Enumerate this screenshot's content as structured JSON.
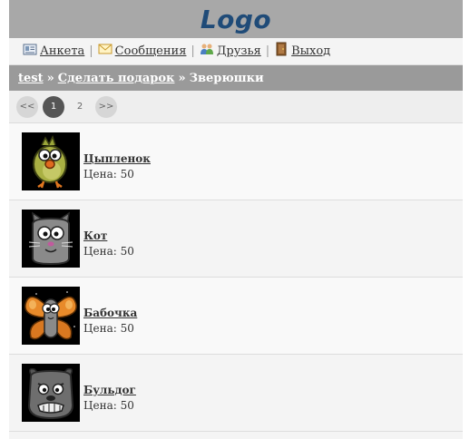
{
  "header": {
    "logo": "Logo"
  },
  "nav": [
    {
      "label": "Анкета",
      "icon": "profile-card-icon"
    },
    {
      "label": "Сообщения",
      "icon": "envelope-icon"
    },
    {
      "label": "Друзья",
      "icon": "friends-icon"
    },
    {
      "label": "Выход",
      "icon": "exit-door-icon"
    }
  ],
  "nav_separator": "|",
  "breadcrumb": {
    "items": [
      "test",
      "Сделать подарок",
      "Зверюшки"
    ],
    "separator": "»"
  },
  "pagination": {
    "prev": "<<",
    "pages": [
      "1",
      "2"
    ],
    "current": "1",
    "next": ">>"
  },
  "price_label": "Цена:",
  "items": [
    {
      "name": "Цыпленок",
      "price_text": "Цена: 50",
      "price": 50,
      "image": "chick-icon"
    },
    {
      "name": "Кот",
      "price_text": "Цена: 50",
      "price": 50,
      "image": "cat-icon"
    },
    {
      "name": "Бабочка",
      "price_text": "Цена: 50",
      "price": 50,
      "image": "butterfly-icon"
    },
    {
      "name": "Бульдог",
      "price_text": "Цена: 50",
      "price": 50,
      "image": "bulldog-icon"
    }
  ],
  "colors": {
    "header_bg": "#a8a8a8",
    "logo": "#1f4b78",
    "breadcrumb_bg": "#9a9a9a",
    "pager_active": "#555555"
  }
}
